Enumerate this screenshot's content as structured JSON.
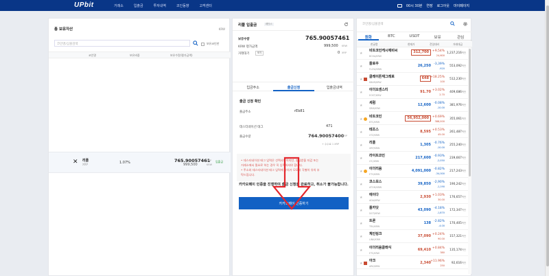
{
  "nav": {
    "logo": "UPbit",
    "menu": [
      "거래소",
      "입출금",
      "투자내역",
      "코인동향",
      "고객센터"
    ],
    "time": "00시 30분",
    "extend": "연장",
    "logout": "로그아웃",
    "mypage": "마이페이지"
  },
  "left": {
    "title": "총 보유자산",
    "unit": "KRW",
    "search_placeholder": "코인명/심볼검색",
    "checkbox": "보유코인만",
    "headers": [
      "코인명",
      "보유비중",
      "보유수량(평가금액)"
    ],
    "row": {
      "name": "리플",
      "symbol": "XRP",
      "pct": "1.07%",
      "amount": "765.90057461",
      "amount_unit": "XRP",
      "value": "999,500",
      "value_unit": "KRW",
      "action": "입출금"
    }
  },
  "mid": {
    "title": "리플 입출금",
    "badge": "레딧스",
    "holding_label": "보유수량",
    "holding": "765.90057461",
    "holding_unit": "XRP",
    "krw_label": "KRW 평가금액",
    "krw": "999,500",
    "krw_unit": "KRW",
    "pending_label": "거래대기",
    "pending_btn": "보기",
    "pending": "0",
    "pending_unit": "XRP",
    "tabs": [
      "입금주소",
      "출금신청",
      "입출금내역"
    ],
    "confirm_title": "출금 신청 확인",
    "addr_label": "출금주소",
    "addr": "rEb81",
    "tag_label": "데스티네이션 태그",
    "tag": "471",
    "qty_label": "출금수량",
    "qty": "764.90057400",
    "qty_unit": "XRP",
    "fee": "+ 수수료 1 XRP",
    "notice": [
      "• 데스티네이션 태그 입력은 선택사항이지만, 송금받을 지갑 또는",
      "  거래소에서 필요로 하는 경우 꼭 입력하셔야 합니다.",
      "• 주소와 데스티네이션 태그 입력에 유의가 모모처 각별히 유의 부",
      "  탁드립니다."
    ],
    "kakao_note": "카카오페이 인증을 진행하여 출금 신청을 완료하고, 취소가 불가능합니다.",
    "kakao_btn": "카카오페이 인증하기"
  },
  "right": {
    "search_placeholder": "코인명/심볼검색",
    "tabs": [
      "원화",
      "BTC",
      "USDT",
      "보유",
      "관심"
    ],
    "headers": [
      "한글명",
      "현재가",
      "전일대비",
      "거래대금"
    ],
    "coins": [
      {
        "name": "비트코인캐시에비씨",
        "sym": "BCHA/KRW",
        "price": "312,700",
        "pct": "+9,54%",
        "chg": "24,600",
        "vol": "1,237,216",
        "unit": "백만",
        "dir": "up",
        "box": true,
        "mark": ""
      },
      {
        "name": "플로우",
        "sym": "FLOW/KRW",
        "price": "26,250",
        "pct": "-3,39%",
        "chg": "-920",
        "vol": "553,092",
        "unit": "백만",
        "dir": "dn",
        "box": false,
        "mark": ""
      },
      {
        "name": "클레이튼재그레로",
        "sym": "KBAR/KRW",
        "price": "648",
        "pct": "+18.25%",
        "chg": "100",
        "vol": "512,230",
        "unit": "백만",
        "dir": "up",
        "box": true,
        "mark": "#c84a31"
      },
      {
        "name": "이더오센스티",
        "sym": "EOST/KRW",
        "price": "91.70",
        "pct": "+3.02%",
        "chg": "2.70",
        "vol": "409,686",
        "unit": "백만",
        "dir": "up",
        "box": false,
        "mark": ""
      },
      {
        "name": "세럼",
        "sym": "SRM/KRW",
        "price": "12,600",
        "pct": "-0.08%",
        "chg": "-10.00",
        "vol": "381,976",
        "unit": "백만",
        "dir": "dn",
        "box": false,
        "mark": ""
      },
      {
        "name": "비트코인",
        "sym": "BTC/KRW",
        "price": "56,952,000",
        "pct": "+0.69%",
        "chg": "388,000",
        "vol": "355,061",
        "unit": "백만",
        "dir": "up",
        "box": true,
        "mark": "#f5a623"
      },
      {
        "name": "테조스",
        "sym": "XTZ/KRW",
        "price": "8,595",
        "pct": "+0.53%",
        "chg": "45.00",
        "vol": "261,487",
        "unit": "백만",
        "dir": "up",
        "box": false,
        "mark": ""
      },
      {
        "name": "리플",
        "sym": "XRP/KRW",
        "price": "1,305",
        "pct": "-0.76%",
        "chg": "-10.00",
        "vol": "255,240",
        "unit": "백만",
        "dir": "dn",
        "box": false,
        "mark": ""
      },
      {
        "name": "라이트코인",
        "sym": "LTC/KRW",
        "price": "217,600",
        "pct": "-0.93%",
        "chg": "-2,050",
        "vol": "239,667",
        "unit": "백만",
        "dir": "dn",
        "box": false,
        "mark": ""
      },
      {
        "name": "이더리움",
        "sym": "ETH/KRW",
        "price": "4,091,000",
        "pct": "-0.82%",
        "chg": "-34,000",
        "vol": "217,243",
        "unit": "백만",
        "dir": "dn",
        "box": false,
        "mark": "#f5a623"
      },
      {
        "name": "코스모스",
        "sym": "ATOM/KRW",
        "price": "39,850",
        "pct": "-2,90%",
        "chg": "-1,190",
        "vol": "190,242",
        "unit": "백만",
        "dir": "dn",
        "box": false,
        "mark": ""
      },
      {
        "name": "에이다",
        "sym": "ADA/KRW",
        "price": "2,930",
        "pct": "+1.03%",
        "chg": "30.00",
        "vol": "176,657",
        "unit": "백만",
        "dir": "up",
        "box": false,
        "mark": ""
      },
      {
        "name": "폴카닷",
        "sym": "DOT/KRW",
        "price": "43,090",
        "pct": "-4.18%",
        "chg": "-1,870",
        "vol": "172,347",
        "unit": "백만",
        "dir": "dn",
        "box": false,
        "mark": ""
      },
      {
        "name": "트론",
        "sym": "TRX/KRW",
        "price": "138",
        "pct": "-2.82%",
        "chg": "-4.00",
        "vol": "170,405",
        "unit": "백만",
        "dir": "dn",
        "box": false,
        "mark": ""
      },
      {
        "name": "체인링크",
        "sym": "LINK/KRW",
        "price": "37,090",
        "pct": "+0.24%",
        "chg": "90.00",
        "vol": "157,321",
        "unit": "백만",
        "dir": "up",
        "box": false,
        "mark": ""
      },
      {
        "name": "이더리움클래식",
        "sym": "ETC/KRW",
        "price": "69,410",
        "pct": "+0.84%",
        "chg": "380",
        "vol": "135,174",
        "unit": "백만",
        "dir": "up",
        "box": false,
        "mark": ""
      },
      {
        "name": "아크",
        "sym": "ARK/KRW",
        "price": "2,340",
        "pct": "+11.96%",
        "chg": "250",
        "vol": "92,616",
        "unit": "백만",
        "dir": "up",
        "box": false,
        "mark": "#c84a31"
      }
    ]
  },
  "colors": {
    "nav": "#093687",
    "accent": "#1261c4",
    "up": "#c84a31",
    "down": "#1261c4",
    "deposit": "#2a9a3a",
    "arrow": "#e4262c"
  }
}
